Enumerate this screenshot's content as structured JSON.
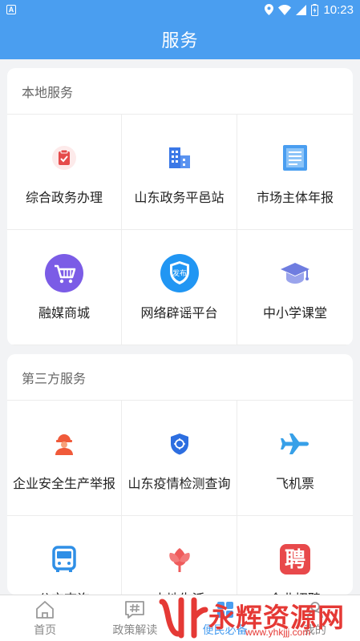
{
  "status": {
    "time": "10:23",
    "notif_icon": "A"
  },
  "header": {
    "title": "服务"
  },
  "sections": [
    {
      "title": "本地服务",
      "items": [
        {
          "label": "综合政务办理",
          "icon": "clipboard-check-icon",
          "color": "#e54b4b"
        },
        {
          "label": "山东政务平邑站",
          "icon": "buildings-icon",
          "color": "#3b78e7"
        },
        {
          "label": "市场主体年报",
          "icon": "document-icon",
          "color": "#4a9ef0"
        },
        {
          "label": "融媒商城",
          "icon": "shopping-cart-icon",
          "color": "#7b5ce6"
        },
        {
          "label": "网络辟谣平台",
          "icon": "shield-badge-icon",
          "color": "#2196f3",
          "badge_text": "发布"
        },
        {
          "label": "中小学课堂",
          "icon": "graduation-cap-icon",
          "color": "#6f7de0"
        }
      ]
    },
    {
      "title": "第三方服务",
      "items": [
        {
          "label": "企业安全生产举报",
          "icon": "worker-icon",
          "color": "#f05a3a"
        },
        {
          "label": "山东疫情检测查询",
          "icon": "virus-shield-icon",
          "color": "#2d6ee0"
        },
        {
          "label": "飞机票",
          "icon": "airplane-icon",
          "color": "#37a0e8"
        },
        {
          "label": "公交查询",
          "icon": "bus-icon",
          "color": "#2f8fe6"
        },
        {
          "label": "本地生活",
          "icon": "tulip-icon",
          "color": "#ef5b5b"
        },
        {
          "label": "企业招聘",
          "icon": "recruit-icon",
          "color": "#e8494b",
          "badge_text": "聘"
        }
      ]
    }
  ],
  "tabbar": {
    "items": [
      {
        "label": "首页",
        "icon": "home-icon"
      },
      {
        "label": "政策解读",
        "icon": "hashtag-icon"
      },
      {
        "label": "便民必备",
        "icon": "grid-icon",
        "active": true
      },
      {
        "label": "我的",
        "icon": "user-icon"
      }
    ]
  },
  "watermark": {
    "text": "永辉资源网",
    "url": "www.yhkjjj.com"
  },
  "colors": {
    "primary": "#4a9ef0",
    "background": "#f2f3f5"
  }
}
